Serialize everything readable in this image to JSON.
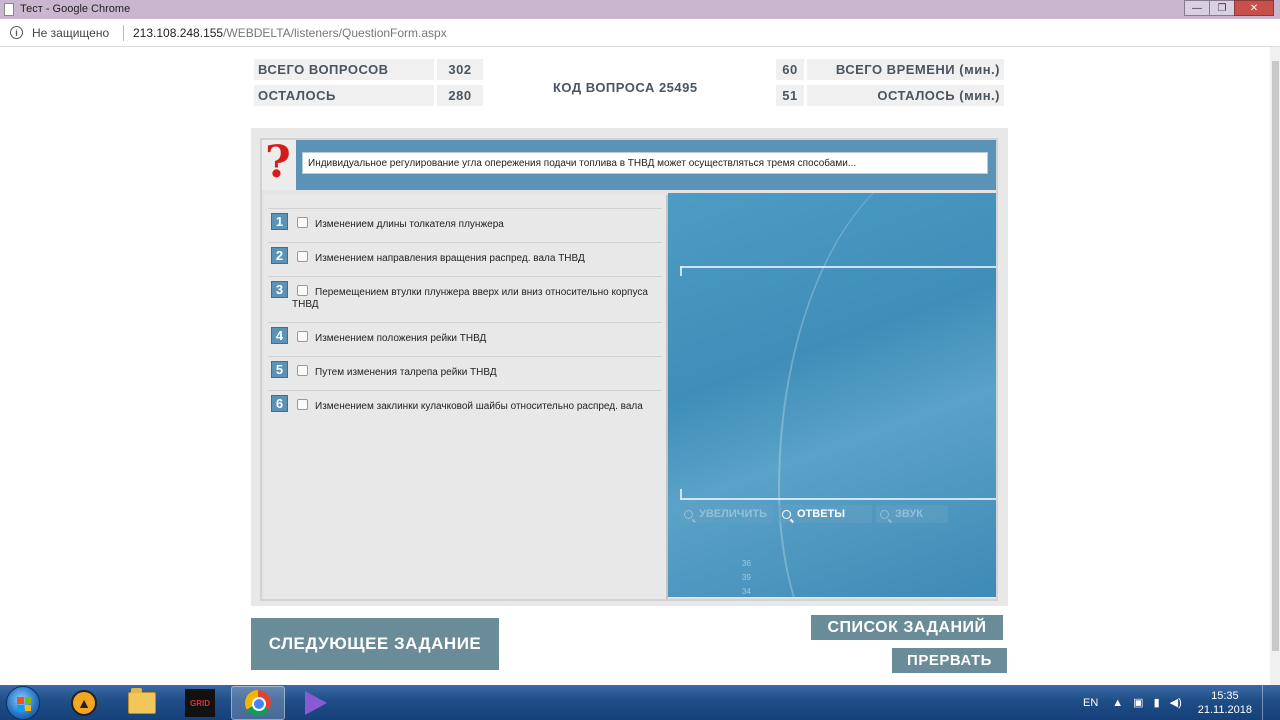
{
  "window": {
    "title": "Тест - Google Chrome",
    "controls": {
      "minimize": "—",
      "maximize": "❐",
      "close": "✕"
    }
  },
  "address_bar": {
    "security_label": "Не защищено",
    "url_host": "213.108.248.155",
    "url_path": "/WEBDELTA/listeners/QuestionForm.aspx"
  },
  "stats": {
    "total_questions_label": "ВСЕГО ВОПРОСОВ",
    "total_questions_value": "302",
    "remaining_label": "ОСТАЛОСЬ",
    "remaining_value": "280",
    "question_code": "КОД ВОПРОСА 25495",
    "total_time_value": "60",
    "total_time_label": "ВСЕГО ВРЕМЕНИ (мин.)",
    "remaining_time_value": "51",
    "remaining_time_label": "ОСТАЛОСЬ (мин.)"
  },
  "question": {
    "icon": "question-mark-icon",
    "mark": "?",
    "text": "Индивидуальное регулирование угла опережения подачи топлива в ТНВД может осуществляться тремя способами..."
  },
  "answers": [
    {
      "num": "1",
      "text": "Изменением длины толкателя плунжера"
    },
    {
      "num": "2",
      "text": "Изменением направления вращения распред. вала ТНВД"
    },
    {
      "num": "3",
      "text": "Перемещением втулки плунжера вверх или вниз относительно корпуса ТНВД"
    },
    {
      "num": "4",
      "text": "Изменением положения рейки ТНВД"
    },
    {
      "num": "5",
      "text": "Путем изменения талрепа рейки ТНВД"
    },
    {
      "num": "6",
      "text": "Изменением заклинки кулачковой шайбы относительно распред. вала"
    }
  ],
  "image_tools": {
    "zoom": "УВЕЛИЧИТЬ",
    "answers": "ОТВЕТЫ",
    "sound": "ЗВУК"
  },
  "image_page_numbers": [
    "36",
    "39",
    "34"
  ],
  "buttons": {
    "next": "СЛЕДУЮЩЕЕ ЗАДАНИЕ",
    "task_list": "СПИСОК ЗАДАНИЙ",
    "abort": "ПРЕРВАТЬ"
  },
  "taskbar": {
    "grid_label": "GRID",
    "language": "EN",
    "time": "15:35",
    "date": "21.11.2018",
    "tray_icons": [
      "arrow-up-icon",
      "network-plug-icon",
      "signal-icon",
      "speaker-icon"
    ]
  },
  "colors": {
    "accent_blue": "#5b93b7",
    "button": "#6a8c98",
    "question_mark_red": "#d41c1c"
  }
}
